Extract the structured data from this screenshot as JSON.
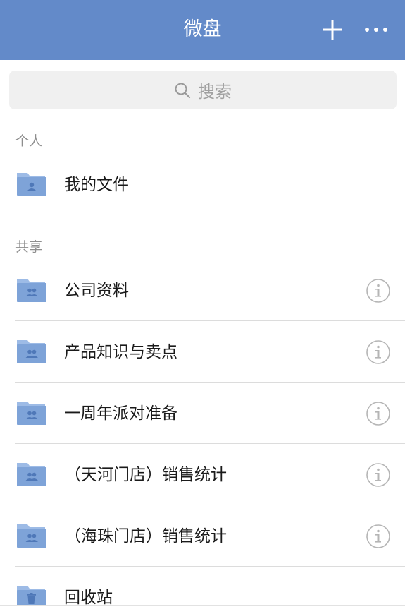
{
  "header": {
    "title": "微盘",
    "add_icon": "plus-icon",
    "more_icon": "more-horizontal-icon"
  },
  "search": {
    "placeholder": "搜索",
    "icon": "search-icon"
  },
  "sections": {
    "personal_label": "个人",
    "shared_label": "共享"
  },
  "personal_items": [
    {
      "label": "我的文件",
      "icon": "personal-folder-icon"
    }
  ],
  "shared_items": [
    {
      "label": "公司资料",
      "icon": "shared-folder-icon",
      "info_icon": "info-icon"
    },
    {
      "label": "产品知识与卖点",
      "icon": "shared-folder-icon",
      "info_icon": "info-icon"
    },
    {
      "label": "一周年派对准备",
      "icon": "shared-folder-icon",
      "info_icon": "info-icon"
    },
    {
      "label": "（天河门店）销售统计",
      "icon": "shared-folder-icon",
      "info_icon": "info-icon"
    },
    {
      "label": "（海珠门店）销售统计",
      "icon": "shared-folder-icon",
      "info_icon": "info-icon"
    }
  ],
  "trash": {
    "label": "回收站",
    "icon": "trash-folder-icon"
  },
  "colors": {
    "header_bg": "#638ac9",
    "folder": "#7ea3d8",
    "folder_dark": "#5f86c4",
    "info": "#b5b5b5"
  }
}
